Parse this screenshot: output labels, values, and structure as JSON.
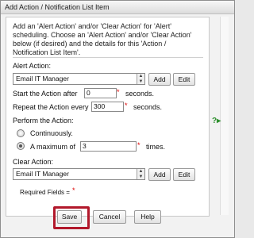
{
  "window": {
    "title": "Add Action / Notification List Item"
  },
  "description": "Add an 'Alert Action' and/or 'Clear Action' for 'Alert' scheduling. Choose an 'Alert Action' and/or 'Clear Action' below (if desired) and the details for this 'Action / Notification List Item'.",
  "alert_action": {
    "label": "Alert Action:",
    "selected": "Email IT Manager",
    "add_label": "Add",
    "edit_label": "Edit"
  },
  "start_after": {
    "label": "Start the Action after",
    "value": "0",
    "required": "*",
    "unit": "seconds."
  },
  "repeat_every": {
    "label": "Repeat the Action every",
    "value": "300",
    "required": "*",
    "unit": "seconds."
  },
  "perform": {
    "label": "Perform the Action:",
    "continuously": "Continuously.",
    "maximum_label": "A maximum of",
    "maximum_value": "3",
    "required": "*",
    "times": "times."
  },
  "clear_action": {
    "label": "Clear Action:",
    "selected": "Email IT Manager",
    "add_label": "Add",
    "edit_label": "Edit"
  },
  "required_fields": {
    "label": "Required Fields =",
    "marker": "*"
  },
  "footer": {
    "save": "Save",
    "cancel": "Cancel",
    "help": "Help"
  },
  "help_icon": {
    "text": "?▸"
  },
  "colors": {
    "accent_red": "#b2182b",
    "required": "#dd0000",
    "help_green": "#2d8f2d"
  }
}
